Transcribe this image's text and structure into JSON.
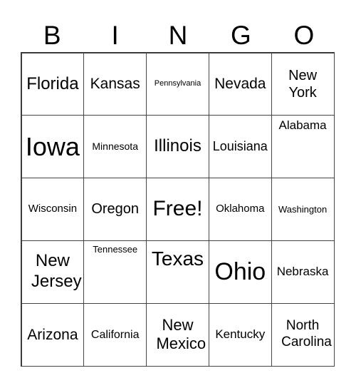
{
  "header": [
    "B",
    "I",
    "N",
    "G",
    "O"
  ],
  "cells": [
    {
      "text": "Florida",
      "size": 24
    },
    {
      "text": "Kansas",
      "size": 21
    },
    {
      "text": "Pennsylvania",
      "size": 11
    },
    {
      "text": "Nevada",
      "size": 21
    },
    {
      "text": "New York",
      "size": 20
    },
    {
      "text": "Iowa",
      "size": 36
    },
    {
      "text": "Minnesota",
      "size": 14
    },
    {
      "text": "Illinois",
      "size": 24
    },
    {
      "text": "Louisiana",
      "size": 18
    },
    {
      "text": "Alabama",
      "size": 17,
      "up": true
    },
    {
      "text": "Wisconsin",
      "size": 15
    },
    {
      "text": "Oregon",
      "size": 20
    },
    {
      "text": "Free!",
      "size": 30
    },
    {
      "text": "Oklahoma",
      "size": 15
    },
    {
      "text": "Washington",
      "size": 13
    },
    {
      "text": "New Jersey",
      "size": 24
    },
    {
      "text": "Tennessee",
      "size": 13,
      "up": true
    },
    {
      "text": "Texas",
      "size": 28,
      "up": true
    },
    {
      "text": "Ohio",
      "size": 34
    },
    {
      "text": "Nebraska",
      "size": 17
    },
    {
      "text": "Arizona",
      "size": 21
    },
    {
      "text": "California",
      "size": 16
    },
    {
      "text": "New Mexico",
      "size": 22
    },
    {
      "text": "Kentucky",
      "size": 17
    },
    {
      "text": "North Carolina",
      "size": 19
    }
  ]
}
